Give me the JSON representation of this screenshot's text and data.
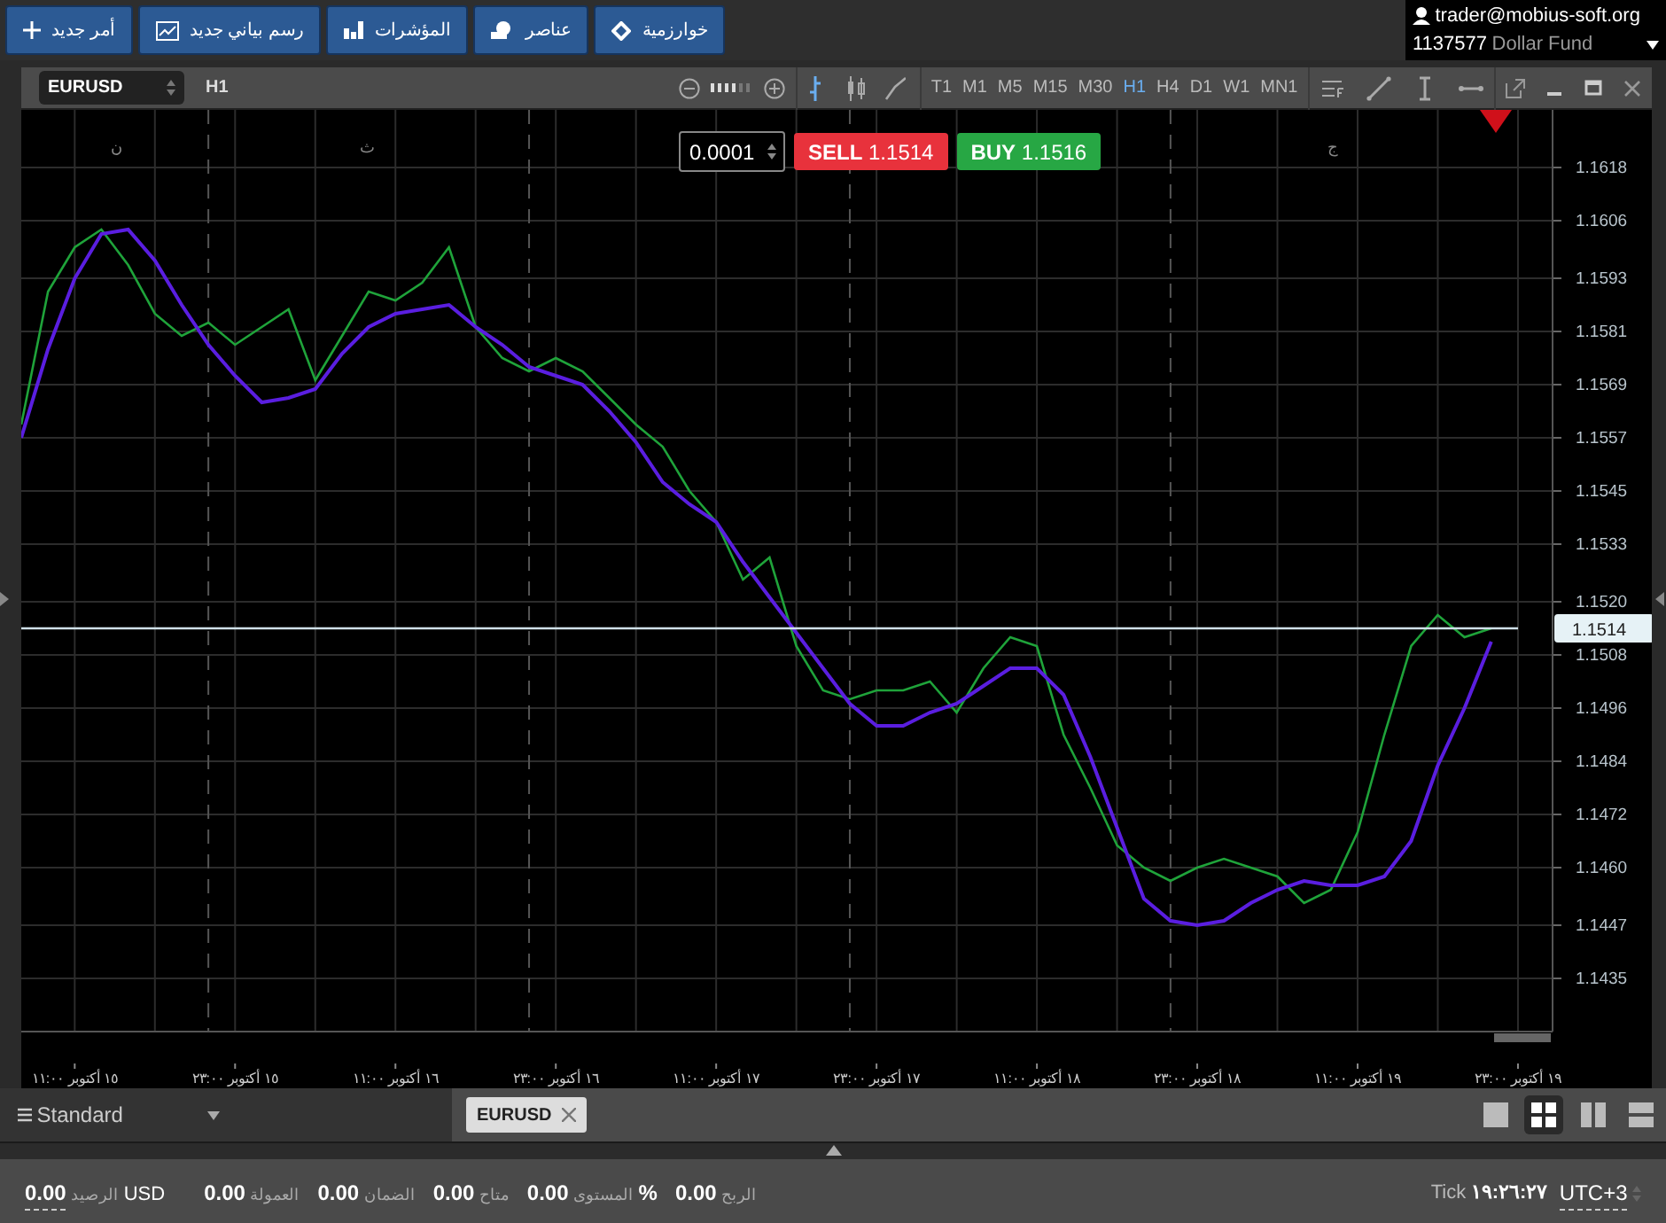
{
  "toolbar": {
    "buttons": [
      {
        "label": "خوارزمية",
        "kind": "diamond"
      },
      {
        "label": "عناصر",
        "kind": "shapes"
      },
      {
        "label": "المؤشرات",
        "kind": "bars"
      },
      {
        "label": "رسم بياني جديد",
        "kind": "chart"
      },
      {
        "label": "أمر جديد",
        "kind": "plus"
      }
    ]
  },
  "account": {
    "user": "trader@mobius-soft.org",
    "number": "1137577",
    "name": "Dollar Fund"
  },
  "chart_window": {
    "symbol": "EURUSD",
    "timeframe": "H1",
    "zoom": {
      "level": 0.67
    },
    "chart_types": [
      {
        "kind": "bar",
        "selected": true
      },
      {
        "kind": "candle",
        "selected": false
      },
      {
        "kind": "line",
        "selected": false
      }
    ],
    "timeframes": [
      {
        "label": "MN1",
        "selected": false
      },
      {
        "label": "W1",
        "selected": false
      },
      {
        "label": "D1",
        "selected": false
      },
      {
        "label": "H4",
        "selected": false
      },
      {
        "label": "H1",
        "selected": true
      },
      {
        "label": "M30",
        "selected": false
      },
      {
        "label": "M15",
        "selected": false
      },
      {
        "label": "M5",
        "selected": false
      },
      {
        "label": "M1",
        "selected": false
      },
      {
        "label": "T1",
        "selected": false
      }
    ],
    "trade": {
      "lot": "0.0001",
      "sell_label": "SELL",
      "sell_price": "1.1514",
      "buy_label": "BUY",
      "buy_price": "1.1516"
    },
    "day_labels": [
      "ج",
      "ث",
      "ن"
    ],
    "current_price": "1.1514",
    "chart_data": {
      "type": "line",
      "categories": [
        null,
        null,
        "١٥ أكتوبر ١١:٠٠",
        null,
        null,
        null,
        null,
        null,
        "١٥ أكتوبر ٢٣:٠٠",
        null,
        null,
        null,
        null,
        null,
        "١٦ أكتوبر ١١:٠٠",
        null,
        null,
        null,
        null,
        null,
        "١٦ أكتوبر ٢٣:٠٠",
        null,
        null,
        null,
        null,
        null,
        "١٧ أكتوبر ١١:٠٠",
        null,
        null,
        null,
        null,
        null,
        "١٧ أكتوبر ٢٣:٠٠",
        null,
        null,
        null,
        null,
        null,
        "١٨ أكتوبر ١١:٠٠",
        null,
        null,
        null,
        null,
        null,
        "١٨ أكتوبر ٢٣:٠٠",
        null,
        null,
        null,
        null,
        null,
        "١٩ أكتوبر ١١:٠٠",
        null,
        null,
        null,
        null,
        null,
        "١٩ أكتوبر ٢٣:٠٠"
      ],
      "series": [
        {
          "color": "#1fa33a",
          "values": [
            1.156,
            1.159,
            1.16,
            1.1604,
            1.1596,
            1.1585,
            1.158,
            1.1583,
            1.1578,
            1.1582,
            1.1586,
            1.157,
            1.158,
            1.159,
            1.1588,
            1.1592,
            1.16,
            1.1582,
            1.1575,
            1.1572,
            1.1575,
            1.1572,
            1.1566,
            1.156,
            1.1555,
            1.1545,
            1.1538,
            1.1525,
            1.153,
            1.151,
            1.15,
            1.1498,
            1.15,
            1.15,
            1.1502,
            1.1495,
            1.1505,
            1.1512,
            1.151,
            1.149,
            1.1478,
            1.1465,
            1.146,
            1.1457,
            1.146,
            1.1462,
            1.146,
            1.1458,
            1.1452,
            1.1455,
            1.1468,
            1.149,
            1.151,
            1.1517,
            1.1512,
            1.1514,
            null
          ]
        },
        {
          "color": "#5a1ee0",
          "values": [
            1.1557,
            1.1577,
            1.1593,
            1.1603,
            1.1604,
            1.1597,
            1.1587,
            1.1578,
            1.1571,
            1.1565,
            1.1566,
            1.1568,
            1.1576,
            1.1582,
            1.1585,
            1.1586,
            1.1587,
            1.1582,
            1.1578,
            1.1573,
            1.1571,
            1.1569,
            1.1563,
            1.1556,
            1.1547,
            1.1542,
            1.1538,
            1.1529,
            1.1521,
            1.1513,
            1.1505,
            1.1497,
            1.1492,
            1.1492,
            1.1495,
            1.1497,
            1.1501,
            1.1505,
            1.1505,
            1.1499,
            1.1485,
            1.1469,
            1.1453,
            1.1448,
            1.1447,
            1.1448,
            1.1452,
            1.1455,
            1.1457,
            1.1456,
            1.1456,
            1.1458,
            1.1466,
            1.1483,
            1.1496,
            1.1511,
            null
          ]
        },
        {
          "color": "#cfe0e8",
          "values": [
            1.1514,
            1.1514,
            1.1514,
            1.1514,
            1.1514,
            1.1514,
            1.1514,
            1.1514,
            1.1514,
            1.1514,
            1.1514,
            1.1514,
            1.1514,
            1.1514,
            1.1514,
            1.1514,
            1.1514,
            1.1514,
            1.1514,
            1.1514,
            1.1514,
            1.1514,
            1.1514,
            1.1514,
            1.1514,
            1.1514,
            1.1514,
            1.1514,
            1.1514,
            1.1514,
            1.1514,
            1.1514,
            1.1514,
            1.1514,
            1.1514,
            1.1514,
            1.1514,
            1.1514,
            1.1514,
            1.1514,
            1.1514,
            1.1514,
            1.1514,
            1.1514,
            1.1514,
            1.1514,
            1.1514,
            1.1514,
            1.1514,
            1.1514,
            1.1514,
            1.1514,
            1.1514,
            1.1514,
            1.1514,
            1.1514,
            1.1514
          ]
        }
      ],
      "ylim": [
        1.1423,
        1.1631
      ],
      "grid": true,
      "yticks": [
        {
          "value": 1.1618,
          "label": "1.1618"
        },
        {
          "value": 1.1606,
          "label": "1.1606"
        },
        {
          "value": 1.1593,
          "label": "1.1593"
        },
        {
          "value": 1.1581,
          "label": "1.1581"
        },
        {
          "value": 1.1569,
          "label": "1.1569"
        },
        {
          "value": 1.1557,
          "label": "1.1557"
        },
        {
          "value": 1.1545,
          "label": "1.1545"
        },
        {
          "value": 1.1533,
          "label": "1.1533"
        },
        {
          "value": 1.152,
          "label": "1.1520"
        },
        {
          "value": 1.1508,
          "label": "1.1508"
        },
        {
          "value": 1.1496,
          "label": "1.1496"
        },
        {
          "value": 1.1484,
          "label": "1.1484"
        },
        {
          "value": 1.1472,
          "label": "1.1472"
        },
        {
          "value": 1.146,
          "label": "1.1460"
        },
        {
          "value": 1.1447,
          "label": "1.1447"
        },
        {
          "value": 1.1435,
          "label": "1.1435"
        }
      ]
    }
  },
  "workspace": {
    "name": "Standard",
    "tabs": [
      {
        "label": "EURUSD",
        "selected": true
      }
    ],
    "layouts": [
      {
        "kind": "single",
        "selected": false
      },
      {
        "kind": "grid",
        "selected": true
      },
      {
        "kind": "columns",
        "selected": false
      },
      {
        "kind": "rows",
        "selected": false
      }
    ]
  },
  "status_bar": {
    "items": [
      {
        "value": "0.00",
        "label": "الربح"
      },
      {
        "value": "0.00",
        "label": "المستوى",
        "unit": "%"
      },
      {
        "value": "0.00",
        "label": "متاح"
      },
      {
        "value": "0.00",
        "label": "الضمان"
      },
      {
        "value": "0.00",
        "label": "العمولة"
      },
      {
        "value": "0.00",
        "label": "الرصيد",
        "unit": "USD"
      }
    ],
    "tick_label": "Tick",
    "time": "١٩:٢٦:٢٧",
    "timezone": "UTC+3"
  }
}
